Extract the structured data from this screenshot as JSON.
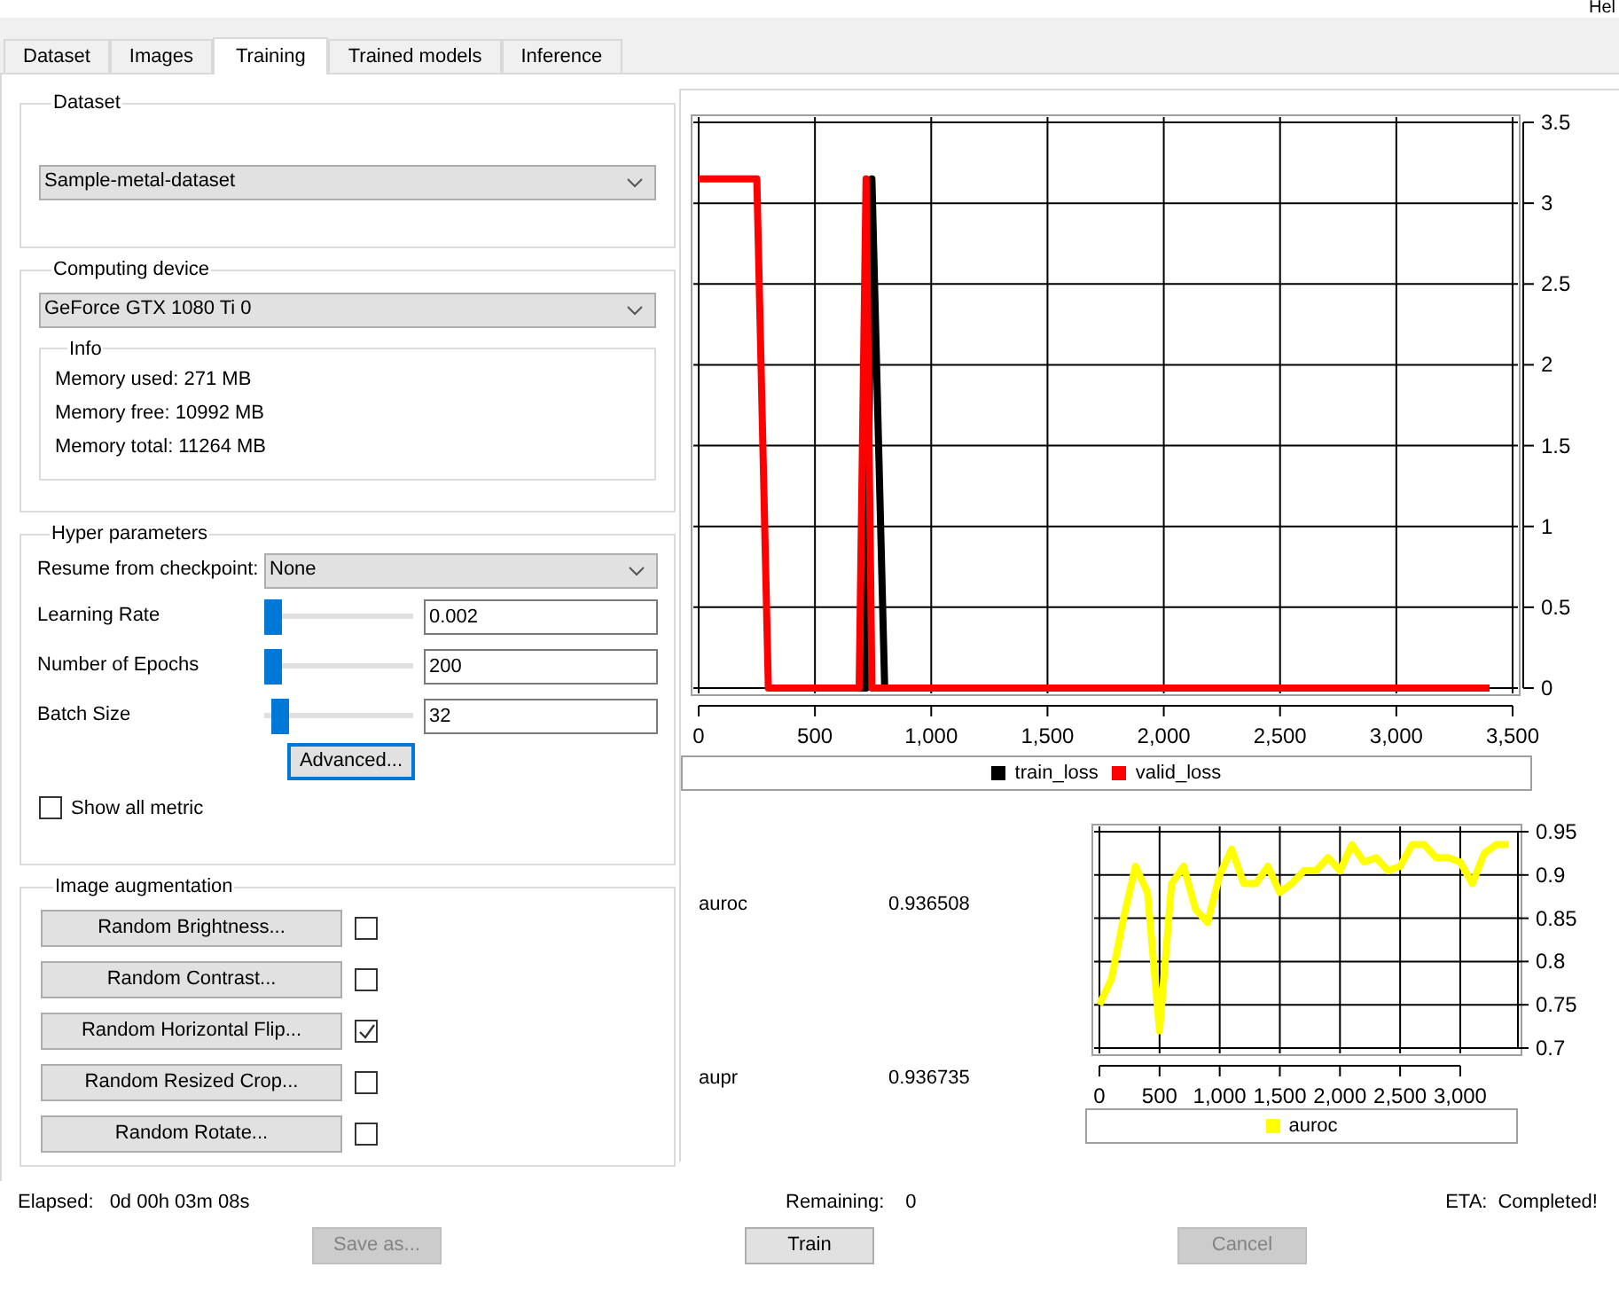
{
  "menu_bar": {
    "label": "Hel"
  },
  "tabs": [
    {
      "label": "Dataset",
      "selected": false
    },
    {
      "label": "Images",
      "selected": false
    },
    {
      "label": "Training",
      "selected": true
    },
    {
      "label": "Trained models",
      "selected": false
    },
    {
      "label": "Inference",
      "selected": false
    }
  ],
  "dataset_group": {
    "title": "Dataset",
    "dropdown": "Sample-metal-dataset"
  },
  "computing_device": {
    "title": "Computing device",
    "dropdown": "GeForce GTX 1080 Ti 0",
    "info": {
      "title": "Info",
      "lines": [
        "Memory used: 271 MB",
        "Memory free: 10992 MB",
        "Memory total: 11264 MB"
      ]
    }
  },
  "hyper_parameters": {
    "title": "Hyper parameters",
    "checkpoint": {
      "label": "Resume from checkpoint:",
      "value": "None"
    },
    "params": [
      {
        "label": "Learning Rate",
        "level": 0.0,
        "value": "0.002"
      },
      {
        "label": "Number of Epochs",
        "level": 0.0,
        "value": "200"
      },
      {
        "label": "Batch Size",
        "level": 0.05,
        "value": "32"
      }
    ],
    "advanced_button": "Advanced...",
    "show_all_metric": {
      "label": "Show all metric",
      "checked": false
    }
  },
  "image_augmentation": {
    "title": "Image augmentation",
    "items": [
      {
        "label": "Random Brightness...",
        "checked": false
      },
      {
        "label": "Random Contrast...",
        "checked": false
      },
      {
        "label": "Random Horizontal Flip...",
        "checked": true
      },
      {
        "label": "Random Resized Crop...",
        "checked": false
      },
      {
        "label": "Random Rotate...",
        "checked": false
      }
    ]
  },
  "loss_chart": {
    "chart_data": {
      "type": "line",
      "grid": true,
      "x": [
        0,
        250,
        300,
        690,
        720,
        745,
        800,
        3400
      ],
      "xlim": [
        0,
        3500
      ],
      "ylim": [
        0,
        3.5
      ],
      "xticks": [
        {
          "value": 0,
          "label": "0"
        },
        {
          "value": 500,
          "label": "500"
        },
        {
          "value": 1000,
          "label": "1,000"
        },
        {
          "value": 1500,
          "label": "1,500"
        },
        {
          "value": 2000,
          "label": "2,000"
        },
        {
          "value": 2500,
          "label": "2,500"
        },
        {
          "value": 3000,
          "label": "3,000"
        },
        {
          "value": 3500,
          "label": "3,500"
        }
      ],
      "yticks": [
        0,
        0.5,
        1,
        1.5,
        2,
        2.5,
        3,
        3.5
      ],
      "series": [
        {
          "name": "train_loss",
          "color": "#000000",
          "values": [
            null,
            null,
            0,
            0,
            0,
            3.15,
            0,
            0
          ]
        },
        {
          "name": "valid_loss",
          "color": "#ff0000",
          "values": [
            3.15,
            3.15,
            0,
            0,
            3.15,
            0,
            0,
            0
          ]
        }
      ]
    }
  },
  "metrics": [
    {
      "name": "auroc",
      "value": "0.936508"
    },
    {
      "name": "aupr",
      "value": "0.936735"
    }
  ],
  "auroc_chart": {
    "chart_data": {
      "type": "line",
      "grid": true,
      "x": [
        0,
        100,
        200,
        300,
        400,
        500,
        600,
        700,
        800,
        900,
        1000,
        1100,
        1200,
        1300,
        1400,
        1500,
        1600,
        1700,
        1800,
        1900,
        2000,
        2100,
        2200,
        2300,
        2400,
        2500,
        2600,
        2700,
        2800,
        2900,
        3000,
        3100,
        3200,
        3300,
        3400
      ],
      "xlim": [
        0,
        3450
      ],
      "ylim": [
        0.7,
        0.95
      ],
      "xticks": [
        {
          "value": 0,
          "label": "0"
        },
        {
          "value": 500,
          "label": "500"
        },
        {
          "value": 1000,
          "label": "1,000"
        },
        {
          "value": 1500,
          "label": "1,500"
        },
        {
          "value": 2000,
          "label": "2,000"
        },
        {
          "value": 2500,
          "label": "2,500"
        },
        {
          "value": 3000,
          "label": "3,000"
        }
      ],
      "yticks": [
        0.7,
        0.75,
        0.8,
        0.85,
        0.9,
        0.95
      ],
      "series": [
        {
          "name": "auroc",
          "color": "#ffff00",
          "values": [
            0.75,
            0.78,
            0.85,
            0.91,
            0.88,
            0.72,
            0.89,
            0.91,
            0.86,
            0.845,
            0.9,
            0.93,
            0.89,
            0.89,
            0.91,
            0.88,
            0.89,
            0.905,
            0.905,
            0.92,
            0.905,
            0.935,
            0.915,
            0.92,
            0.905,
            0.91,
            0.935,
            0.935,
            0.92,
            0.92,
            0.915,
            0.89,
            0.925,
            0.935,
            0.935
          ]
        }
      ]
    }
  },
  "footer": {
    "elapsed": {
      "label": "Elapsed:",
      "value": "0d 00h 03m 08s"
    },
    "remaining": {
      "label": "Remaining:",
      "value": "0"
    },
    "eta": {
      "label": "ETA:",
      "value": "Completed!"
    }
  },
  "buttons": [
    {
      "label": "Save as...",
      "disabled": true
    },
    {
      "label": "Train",
      "disabled": false
    },
    {
      "label": "Cancel",
      "disabled": true
    }
  ]
}
